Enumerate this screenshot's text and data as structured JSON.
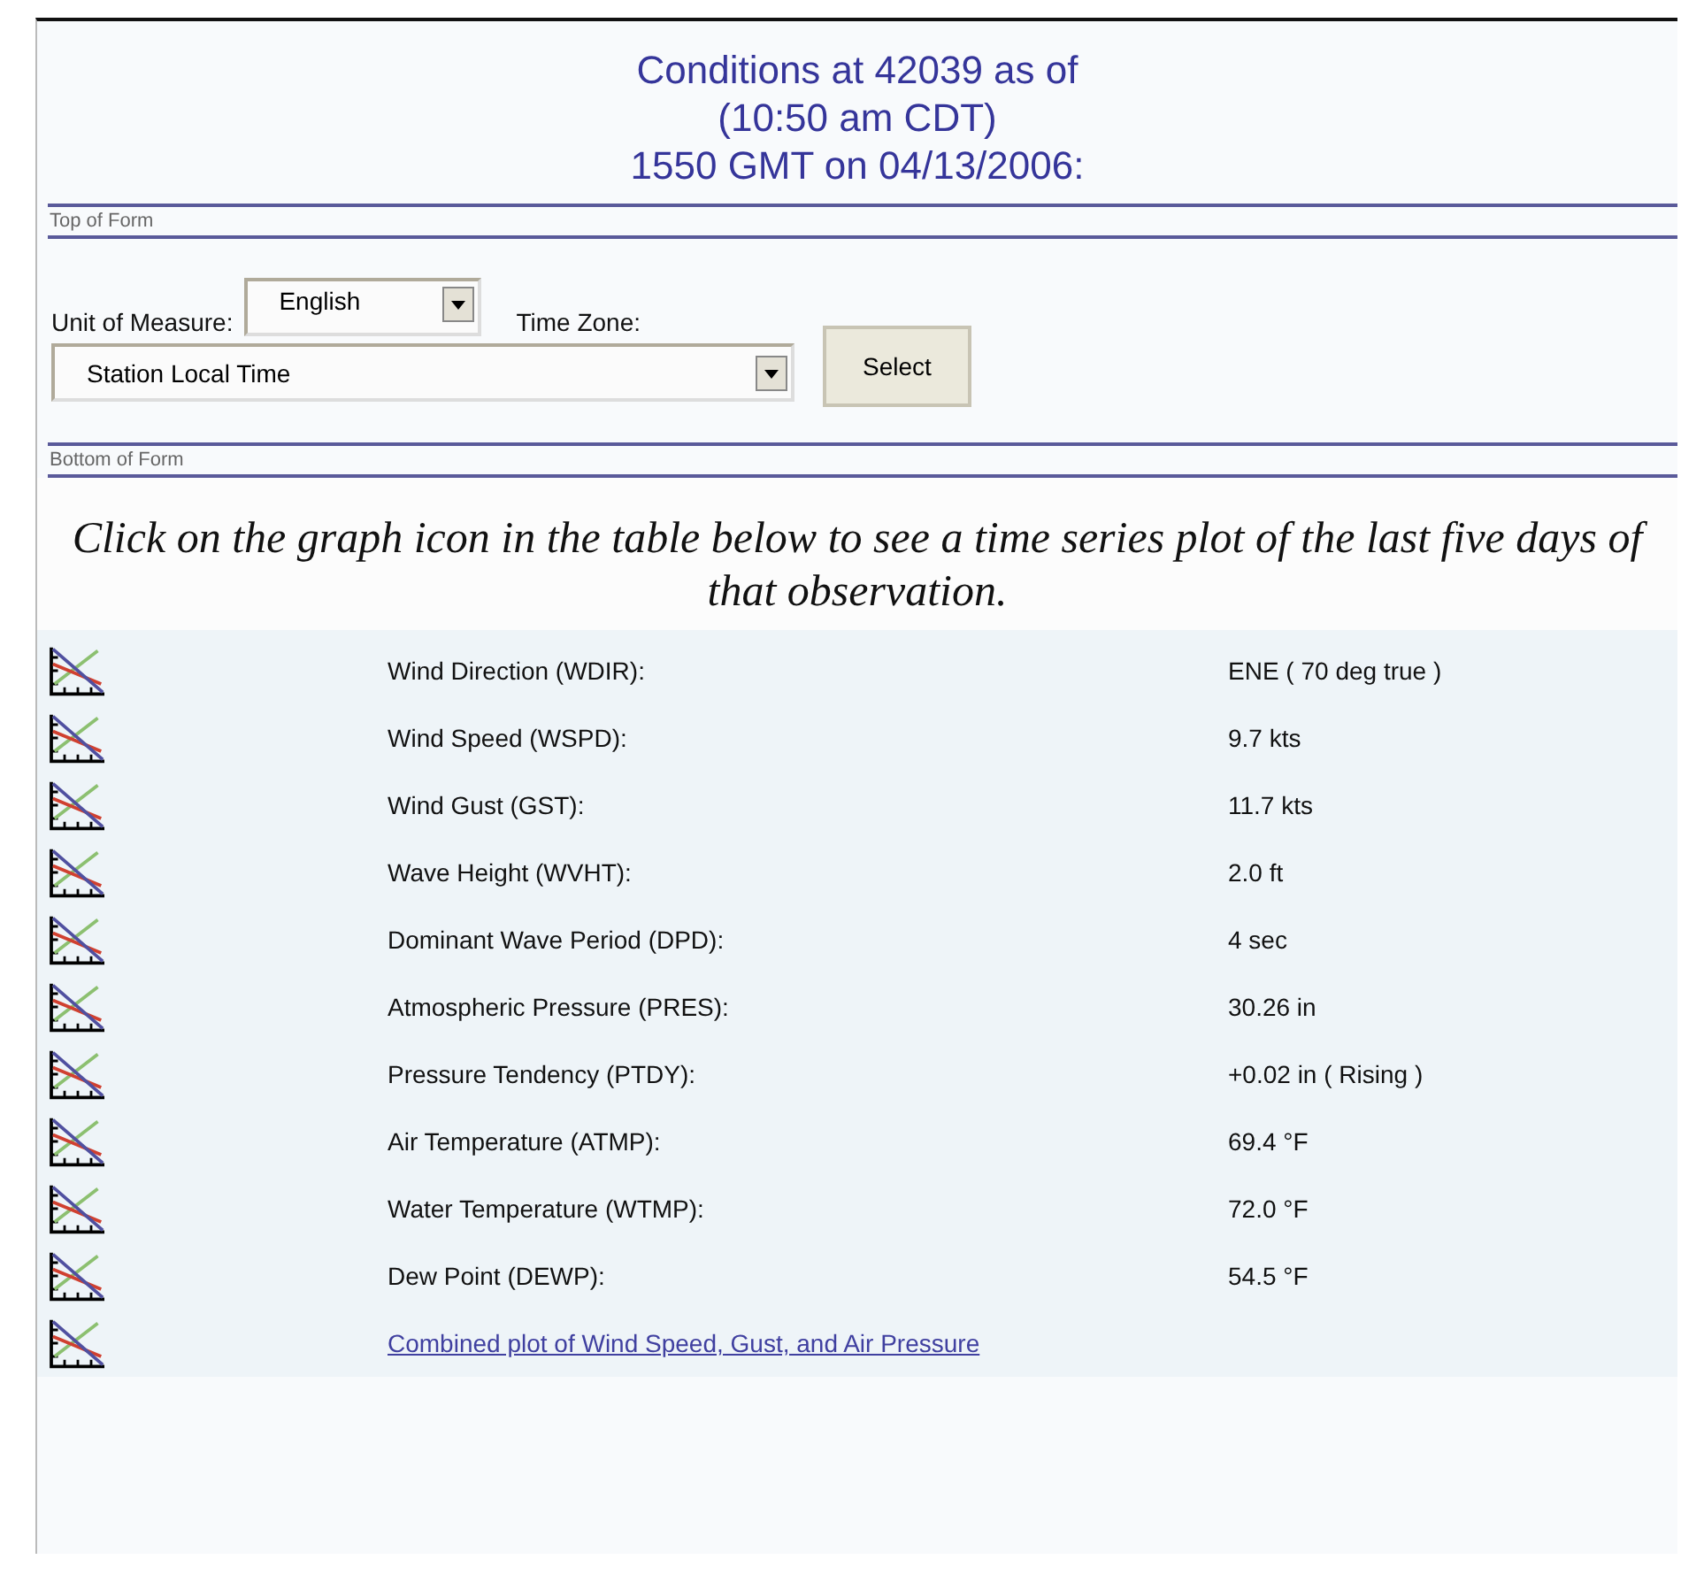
{
  "heading": [
    "Conditions at 42039 as of",
    "(10:50 am CDT)",
    "1550 GMT on 04/13/2006:"
  ],
  "form": {
    "top_label": "Top of Form",
    "unit_label": "Unit of Measure:",
    "unit_value": "English",
    "tz_label": "Time Zone:",
    "tz_value": "Station Local Time",
    "button": "Select",
    "bottom_label": "Bottom of Form"
  },
  "instruction": "Click on the graph icon in the table below to see a time series plot of the last five days of that observation.",
  "rows": [
    {
      "kind": "reading",
      "label": "Wind Direction (WDIR):",
      "value": "ENE ( 70 deg true )"
    },
    {
      "kind": "reading",
      "label": "Wind Speed (WSPD):",
      "value": "9.7 kts"
    },
    {
      "kind": "reading",
      "label": "Wind Gust (GST):",
      "value": "11.7 kts"
    },
    {
      "kind": "reading",
      "label": "Wave Height (WVHT):",
      "value": "2.0 ft"
    },
    {
      "kind": "reading",
      "label": "Dominant Wave Period (DPD):",
      "value": "4 sec"
    },
    {
      "kind": "reading",
      "label": "Atmospheric Pressure (PRES):",
      "value": "30.26 in"
    },
    {
      "kind": "reading",
      "label": "Pressure Tendency (PTDY):",
      "value": "+0.02 in ( Rising )"
    },
    {
      "kind": "reading",
      "label": "Air Temperature (ATMP):",
      "value": "69.4 °F"
    },
    {
      "kind": "reading",
      "label": "Water Temperature (WTMP):",
      "value": "72.0 °F"
    },
    {
      "kind": "reading",
      "label": "Dew Point (DEWP):",
      "value": "54.5 °F"
    },
    {
      "kind": "link",
      "label": "Combined plot of Wind Speed, Gust, and Air Pressure"
    }
  ]
}
